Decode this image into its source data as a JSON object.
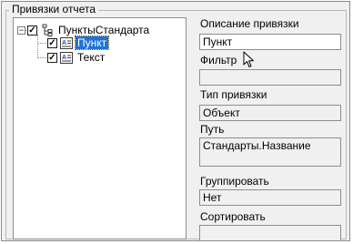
{
  "group": {
    "title": "Привязки отчета"
  },
  "tree": {
    "root": {
      "label": "ПунктыСтандарта",
      "checked": true,
      "expander": "−"
    },
    "children": [
      {
        "label": "Пункт",
        "checked": true,
        "selected": true
      },
      {
        "label": "Текст",
        "checked": true,
        "selected": false
      }
    ]
  },
  "fields": {
    "description": {
      "label": "Описание привязки",
      "value": "Пункт"
    },
    "filter": {
      "label": "Фильтр",
      "value": ""
    },
    "binding_type": {
      "label": "Тип привязки",
      "value": "Объект"
    },
    "path": {
      "label": "Путь",
      "value": "Стандарты.Название"
    },
    "group_by": {
      "label": "Группировать",
      "value": "Нет"
    },
    "sort": {
      "label": "Сортировать",
      "value": ""
    }
  },
  "check_glyph": "✓",
  "icons": {
    "root": "hierarchy-icon",
    "child": "text-field-icon",
    "cursor": "mouse-pointer-icon"
  }
}
